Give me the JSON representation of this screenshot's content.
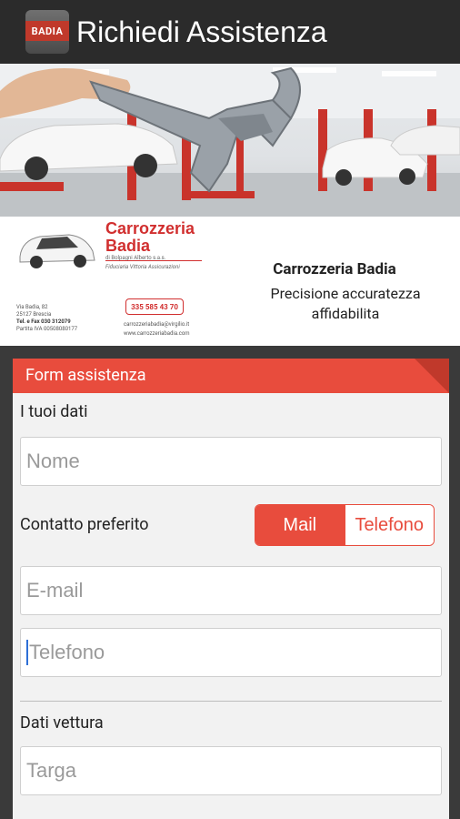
{
  "actionbar": {
    "title": "Richiedi Assistenza",
    "app_icon_text": "BADIA"
  },
  "banner": {
    "brand_line1": "Carrozzeria",
    "brand_line2": "Badia",
    "brand_sub": "di Bolpagni Alberto s.a.s.",
    "brand_sub2": "Fiduciaria Vittoria Assicurazioni",
    "address_line1": "Via Badia, 82",
    "address_line2": "25127 Brescia",
    "address_line3": "Tel. e Fax 030 312079",
    "address_line4": "Partita IVA 00508080177",
    "phone_badge": "335 585 43 70",
    "email": "carrozzeriabadia@virgilio.it",
    "website": "www.carrozzeriabadia.com",
    "title": "Carrozzeria Badia",
    "subtitle": "Precisione accuratezza affidabilita"
  },
  "form": {
    "header": "Form assistenza",
    "section_personal": "I tuoi dati",
    "name_placeholder": "Nome",
    "contact_label": "Contatto preferito",
    "contact_options": [
      "Mail",
      "Telefono"
    ],
    "contact_selected": "Mail",
    "email_placeholder": "E-mail",
    "phone_placeholder": "Telefono",
    "section_vehicle": "Dati vettura",
    "plate_placeholder": "Targa"
  },
  "colors": {
    "accent": "#e84c3d",
    "actionbar": "#2b2b2b"
  }
}
